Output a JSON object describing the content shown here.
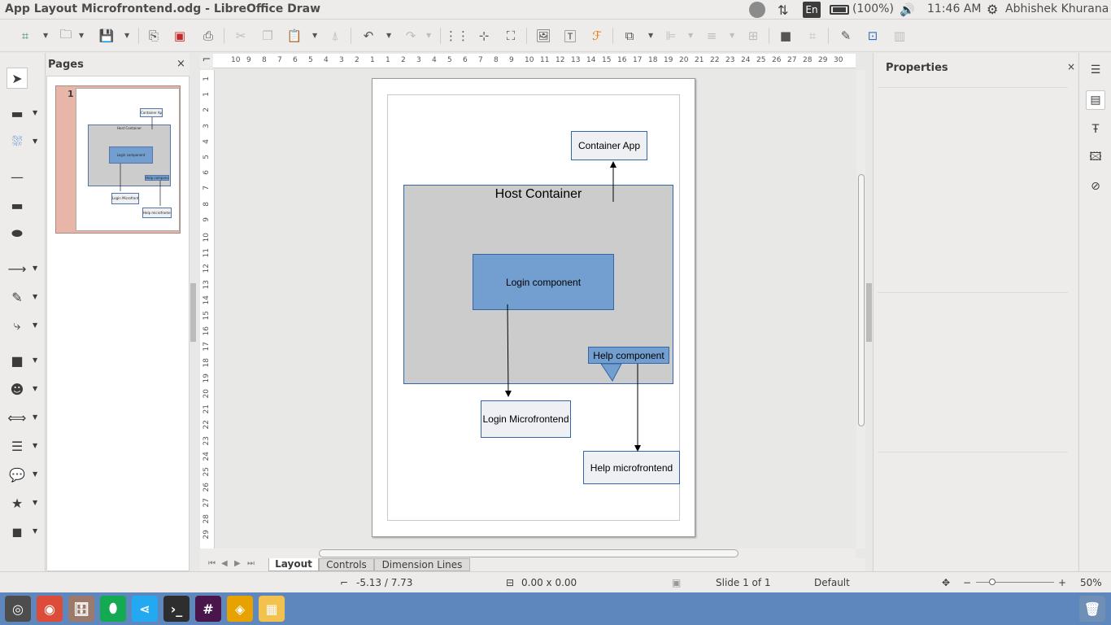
{
  "window": {
    "title": "App Layout Microfrontend.odg - LibreOffice Draw"
  },
  "indicators": {
    "battery": "(100%)",
    "time": "11:46 AM",
    "user": "Abhishek Khurana",
    "lang": "En"
  },
  "pages_panel": {
    "title": "Pages",
    "close": "×",
    "thumbnail_number": "1"
  },
  "thumbnail_labels": {
    "container_app": "Container App",
    "host_container": "Host Container",
    "login_component": "Login component",
    "help_component": "Help component",
    "login_mf": "Login Microfrontend",
    "help_mf": "Help microfrontend"
  },
  "canvas": {
    "host_container": "Host Container",
    "container_app": "Container App",
    "login_component": "Login component",
    "help_component": "Help component",
    "login_microfrontend": "Login Microfrontend",
    "help_microfrontend": "Help microfrontend"
  },
  "ruler": {
    "horizontal": [
      "10",
      "9",
      "8",
      "7",
      "6",
      "5",
      "4",
      "3",
      "2",
      "1",
      "1",
      "2",
      "3",
      "4",
      "5",
      "6",
      "7",
      "8",
      "9",
      "10",
      "11",
      "12",
      "13",
      "14",
      "15",
      "16",
      "17",
      "18",
      "19",
      "20",
      "21",
      "22",
      "23",
      "24",
      "25",
      "26",
      "27",
      "28",
      "29",
      "30"
    ],
    "vertical": [
      "1",
      "1",
      "2",
      "3",
      "4",
      "5",
      "6",
      "7",
      "8",
      "9",
      "10",
      "11",
      "12",
      "13",
      "14",
      "15",
      "16",
      "17",
      "18",
      "19",
      "20",
      "21",
      "22",
      "23",
      "24",
      "25",
      "26",
      "27",
      "28",
      "29"
    ]
  },
  "tabs": {
    "layout": "Layout",
    "controls": "Controls",
    "dimension_lines": "Dimension Lines"
  },
  "properties": {
    "title": "Properties",
    "close": "×"
  },
  "status": {
    "position": "-5.13 / 7.73",
    "size": "0.00 x 0.00",
    "slide": "Slide 1 of 1",
    "master": "Default",
    "zoom": "50%"
  },
  "colors": {
    "accent": "#729fcf",
    "border": "#3465a4",
    "host_fill": "#cccccc",
    "launcher": "#5e88bd"
  },
  "icons": {
    "toolbar": [
      "zoom-pan-icon",
      "open-icon",
      "save-icon",
      "export-icon",
      "export-pdf-icon",
      "print-icon",
      "cut-icon",
      "copy-icon",
      "paste-icon",
      "clone-formatting-icon",
      "undo-icon",
      "redo-icon",
      "grid-icon",
      "helplines-icon",
      "zoom-icon",
      "image-icon",
      "textbox-icon",
      "fontwork-icon",
      "transformations-icon",
      "align-icon",
      "arrange-icon",
      "distribute-icon",
      "shadow-icon",
      "crop-icon",
      "points-icon",
      "glue-icon",
      "3d-icon"
    ],
    "sidebar": [
      "properties-icon",
      "styles-icon",
      "gallery-icon",
      "navigator-icon",
      "shapes-icon"
    ]
  }
}
